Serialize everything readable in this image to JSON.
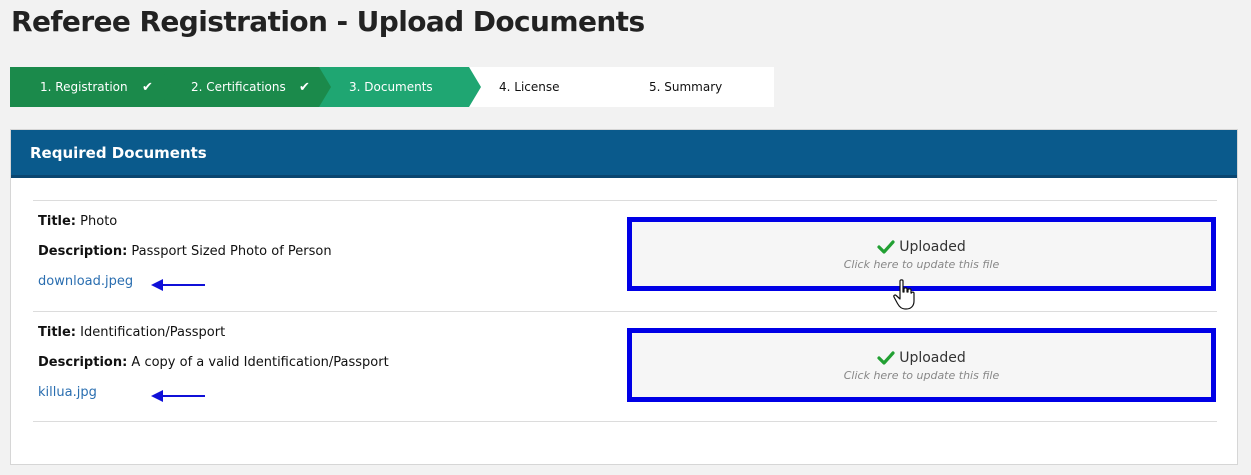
{
  "page": {
    "title": "Referee Registration - Upload Documents"
  },
  "stepper": {
    "steps": [
      {
        "label": "1. Registration",
        "state": "done"
      },
      {
        "label": "2. Certifications",
        "state": "done"
      },
      {
        "label": "3. Documents",
        "state": "active"
      },
      {
        "label": "4. License",
        "state": "todo"
      },
      {
        "label": "5. Summary",
        "state": "todo"
      }
    ],
    "check_glyph": "✔"
  },
  "panel": {
    "header": "Required Documents",
    "documents": [
      {
        "title_label": "Title:",
        "title": "Photo",
        "description_label": "Description:",
        "description": "Passport Sized Photo of Person",
        "file_name": "download.jpeg",
        "status": "Uploaded",
        "hint": "Click here to update this file"
      },
      {
        "title_label": "Title:",
        "title": "Identification/Passport",
        "description_label": "Description:",
        "description": "A copy of a valid Identification/Passport",
        "file_name": "killua.jpg",
        "status": "Uploaded",
        "hint": "Click here to update this file"
      }
    ]
  },
  "colors": {
    "step_done": "#1b8a4b",
    "step_active": "#1fa672",
    "panel_header": "#0a5a8c",
    "highlight_border": "#0000e6",
    "link": "#2a6eb0",
    "check": "#22a033"
  },
  "icons": {
    "status_icon": "check-icon",
    "annotation_arrow": "arrow-left-icon",
    "pointer": "hand-pointer-icon"
  }
}
